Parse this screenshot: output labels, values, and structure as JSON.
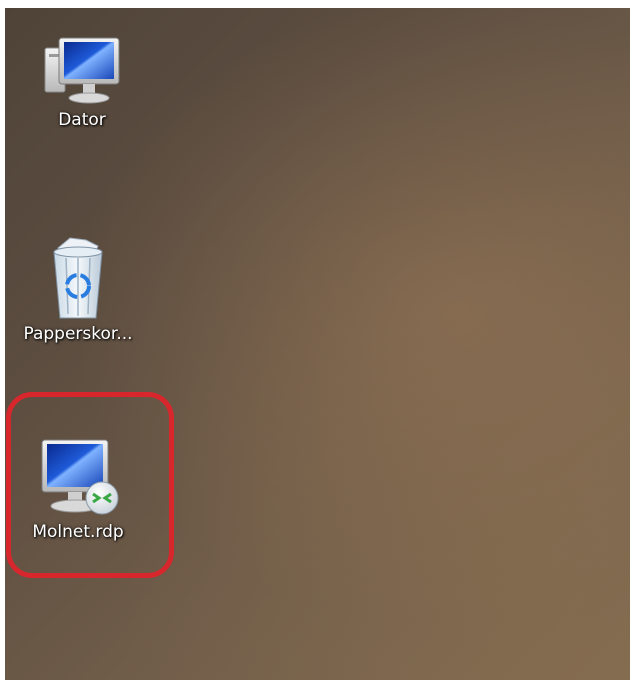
{
  "desktop": {
    "icons": [
      {
        "label": "Dator",
        "icon": "computer-icon"
      },
      {
        "label": "Papperskor...",
        "icon": "recycle-bin-icon"
      },
      {
        "label": "Molnet.rdp",
        "icon": "remote-desktop-icon"
      }
    ],
    "highlight_color": "#d8262d"
  }
}
